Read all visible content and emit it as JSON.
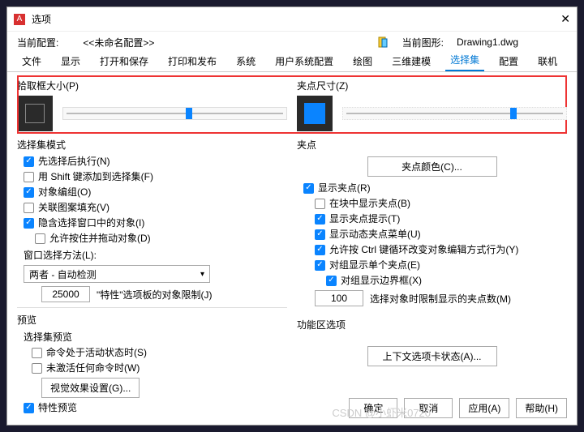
{
  "titlebar": {
    "icon": "A",
    "title": "选项",
    "close": "✕"
  },
  "config": {
    "current_label": "当前配置:",
    "profile_name": "<<未命名配置>>",
    "drawing_label": "当前图形:",
    "drawing_name": "Drawing1.dwg"
  },
  "tabs": [
    "文件",
    "显示",
    "打开和保存",
    "打印和发布",
    "系统",
    "用户系统配置",
    "绘图",
    "三维建模",
    "选择集",
    "配置",
    "联机"
  ],
  "active_tab": "选择集",
  "left": {
    "pickbox_label": "拾取框大小(P)",
    "mode_title": "选择集模式",
    "checks": [
      {
        "label": "先选择后执行(N)",
        "checked": true
      },
      {
        "label": "用 Shift 键添加到选择集(F)",
        "checked": false
      },
      {
        "label": "对象编组(O)",
        "checked": true
      },
      {
        "label": "关联图案填充(V)",
        "checked": false
      },
      {
        "label": "隐含选择窗口中的对象(I)",
        "checked": true
      },
      {
        "label": "允许按住并拖动对象(D)",
        "checked": false,
        "indent": true
      }
    ],
    "window_method_label": "窗口选择方法(L):",
    "window_method_value": "两者 - 自动检测",
    "limit_value": "25000",
    "limit_label": "\"特性\"选项板的对象限制(J)",
    "preview_title": "预览",
    "preview_subtitle": "选择集预览",
    "prev_checks": [
      {
        "label": "命令处于活动状态时(S)",
        "checked": false
      },
      {
        "label": "未激活任何命令时(W)",
        "checked": false
      }
    ],
    "visual_btn": "视觉效果设置(G)...",
    "prop_preview": {
      "label": "特性预览",
      "checked": true
    }
  },
  "right": {
    "gripsize_label": "夹点尺寸(Z)",
    "grip_title": "夹点",
    "grip_color_btn": "夹点颜色(C)...",
    "grip_checks": [
      {
        "label": "显示夹点(R)",
        "checked": true
      },
      {
        "label": "在块中显示夹点(B)",
        "checked": false,
        "indent": 1
      },
      {
        "label": "显示夹点提示(T)",
        "checked": true,
        "indent": 1
      },
      {
        "label": "显示动态夹点菜单(U)",
        "checked": true,
        "indent": 1
      },
      {
        "label": "允许按 Ctrl 键循环改变对象编辑方式行为(Y)",
        "checked": true,
        "indent": 1
      },
      {
        "label": "对组显示单个夹点(E)",
        "checked": true,
        "indent": 1
      },
      {
        "label": "对组显示边界框(X)",
        "checked": true,
        "indent": 2
      }
    ],
    "grip_limit_value": "100",
    "grip_limit_label": "选择对象时限制显示的夹点数(M)",
    "ribbon_title": "功能区选项",
    "ribbon_btn": "上下文选项卡状态(A)..."
  },
  "footer": {
    "ok": "确定",
    "cancel": "取消",
    "apply": "应用(A)",
    "help": "帮助(H)"
  },
  "watermark": "CSDN @小虾米0720"
}
